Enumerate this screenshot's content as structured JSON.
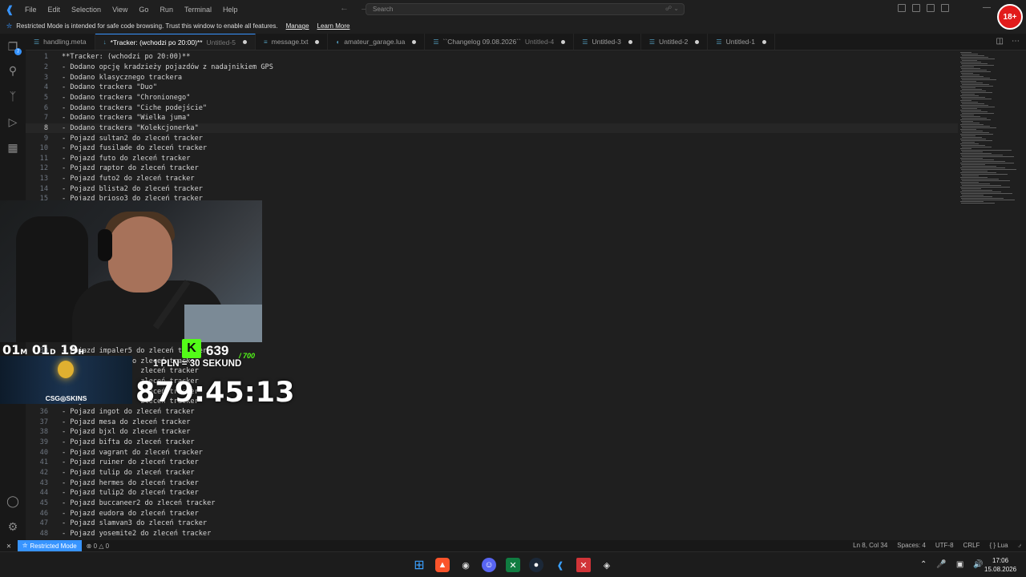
{
  "menu": [
    "File",
    "Edit",
    "Selection",
    "View",
    "Go",
    "Run",
    "Terminal",
    "Help"
  ],
  "search": {
    "placeholder": "Search"
  },
  "age_badge": "18+",
  "banner": {
    "text": "Restricted Mode is intended for safe code browsing. Trust this window to enable all features.",
    "manage": "Manage",
    "learn_more": "Learn More"
  },
  "activity": {
    "badge": "7"
  },
  "tabs": [
    {
      "label": "handling.meta",
      "sub": "",
      "modified": false,
      "active": false,
      "icon": "file-icon"
    },
    {
      "label": "*Tracker: (wchodzi po 20:00)**",
      "sub": "Untitled-5",
      "modified": true,
      "active": true,
      "icon": "markdown-icon"
    },
    {
      "label": "message.txt",
      "sub": "",
      "modified": true,
      "active": false,
      "icon": "text-icon"
    },
    {
      "label": "amateur_garage.lua",
      "sub": "",
      "modified": true,
      "active": false,
      "icon": "lua-icon"
    },
    {
      "label": "``Changelog 09.08.2026``",
      "sub": "Untitled-4",
      "modified": true,
      "active": false,
      "icon": "file-icon"
    },
    {
      "label": "Untitled-3",
      "sub": "",
      "modified": true,
      "active": false,
      "icon": "file-icon"
    },
    {
      "label": "Untitled-2",
      "sub": "",
      "modified": true,
      "active": false,
      "icon": "file-icon"
    },
    {
      "label": "Untitled-1",
      "sub": "",
      "modified": true,
      "active": false,
      "icon": "file-icon"
    }
  ],
  "editor": {
    "current_line": 8,
    "lines": [
      {
        "n": "1",
        "text": "**Tracker: (wchodzi po 20:00)**"
      },
      {
        "n": "2",
        "text": "- Dodano opcję kradzieży pojazdów z nadajnikiem GPS"
      },
      {
        "n": "3",
        "text": "- Dodano klasycznego trackera"
      },
      {
        "n": "4",
        "text": "- Dodano trackera \"Duo\""
      },
      {
        "n": "5",
        "text": "- Dodano trackera \"Chronionego\""
      },
      {
        "n": "6",
        "text": "- Dodano trackera \"Ciche podejście\""
      },
      {
        "n": "7",
        "text": "- Dodano trackera \"Wielka juma\""
      },
      {
        "n": "8",
        "text": "- Dodano trackera \"Kolekcjonerka\""
      },
      {
        "n": "9",
        "text": "- Pojazd sultan2 do zleceń tracker"
      },
      {
        "n": "10",
        "text": "- Pojazd fusilade do zleceń tracker"
      },
      {
        "n": "11",
        "text": "- Pojazd futo do zleceń tracker"
      },
      {
        "n": "12",
        "text": "- Pojazd raptor do zleceń tracker"
      },
      {
        "n": "13",
        "text": "- Pojazd futo2 do zleceń tracker"
      },
      {
        "n": "14",
        "text": "- Pojazd blista2 do zleceń tracker"
      },
      {
        "n": "15",
        "text": "- Pojazd brioso3 do zleceń tracker"
      },
      {
        "n": "",
        "text": ""
      },
      {
        "n": "",
        "text": ""
      },
      {
        "n": "",
        "text": ""
      },
      {
        "n": "",
        "text": ""
      },
      {
        "n": "",
        "text": ""
      },
      {
        "n": "",
        "text": ""
      },
      {
        "n": "",
        "text": ""
      },
      {
        "n": "",
        "text": ""
      },
      {
        "n": "",
        "text": ""
      },
      {
        "n": "",
        "text": ""
      },
      {
        "n": "",
        "text": ""
      },
      {
        "n": "",
        "text": ""
      },
      {
        "n": "",
        "text": ""
      },
      {
        "n": "",
        "text": ""
      },
      {
        "n": "30",
        "text": "- Pojazd impaler5 do zleceń tracker"
      },
      {
        "n": "31",
        "text": "- Pojazd        do zleceń tracker"
      },
      {
        "n": "32",
        "text": "- Pojazd           zleceń tracker"
      },
      {
        "n": "33",
        "text": "- Pojazd           zleceń tracker"
      },
      {
        "n": "34",
        "text": "- Pojazd           zleceń tracker"
      },
      {
        "n": "35",
        "text": "- Pojazd           zleceń tracker"
      },
      {
        "n": "36",
        "text": "- Pojazd ingot do zleceń tracker"
      },
      {
        "n": "37",
        "text": "- Pojazd mesa do zleceń tracker"
      },
      {
        "n": "38",
        "text": "- Pojazd bjxl do zleceń tracker"
      },
      {
        "n": "39",
        "text": "- Pojazd bifta do zleceń tracker"
      },
      {
        "n": "40",
        "text": "- Pojazd vagrant do zleceń tracker"
      },
      {
        "n": "41",
        "text": "- Pojazd ruiner do zleceń tracker"
      },
      {
        "n": "42",
        "text": "- Pojazd tulip do zleceń tracker"
      },
      {
        "n": "43",
        "text": "- Pojazd hermes do zleceń tracker"
      },
      {
        "n": "44",
        "text": "- Pojazd tulip2 do zleceń tracker"
      },
      {
        "n": "45",
        "text": "- Pojazd buccaneer2 do zleceń tracker"
      },
      {
        "n": "46",
        "text": "- Pojazd eudora do zleceń tracker"
      },
      {
        "n": "47",
        "text": "- Pojazd slamvan3 do zleceń tracker"
      },
      {
        "n": "48",
        "text": "- Pojazd yosemite2 do zleceń tracker"
      }
    ]
  },
  "statusbar": {
    "restricted": "Restricted Mode",
    "errors": "0",
    "warnings": "0",
    "position": "Ln 8, Col 34",
    "spaces": "Spaces: 4",
    "encoding": "UTF-8",
    "eol": "CRLF",
    "language": "Lua"
  },
  "overlay": {
    "counter_text": "01M 01D 19H",
    "counter_m": "01",
    "counter_d": "01",
    "counter_h": "19",
    "csgo_label": "CSG◎SKINS",
    "kick_letter": "K",
    "kick_count": "639",
    "kick_goal": "/ 700",
    "pln_text": "1 PLN = 30 SEKUND",
    "timer": "879:45:13"
  },
  "clock": {
    "time": "17:06",
    "date": "15.08.2026"
  },
  "colors": {
    "accent": "#3794ff",
    "kick_green": "#53fc18",
    "age_red": "#e21b1b"
  }
}
